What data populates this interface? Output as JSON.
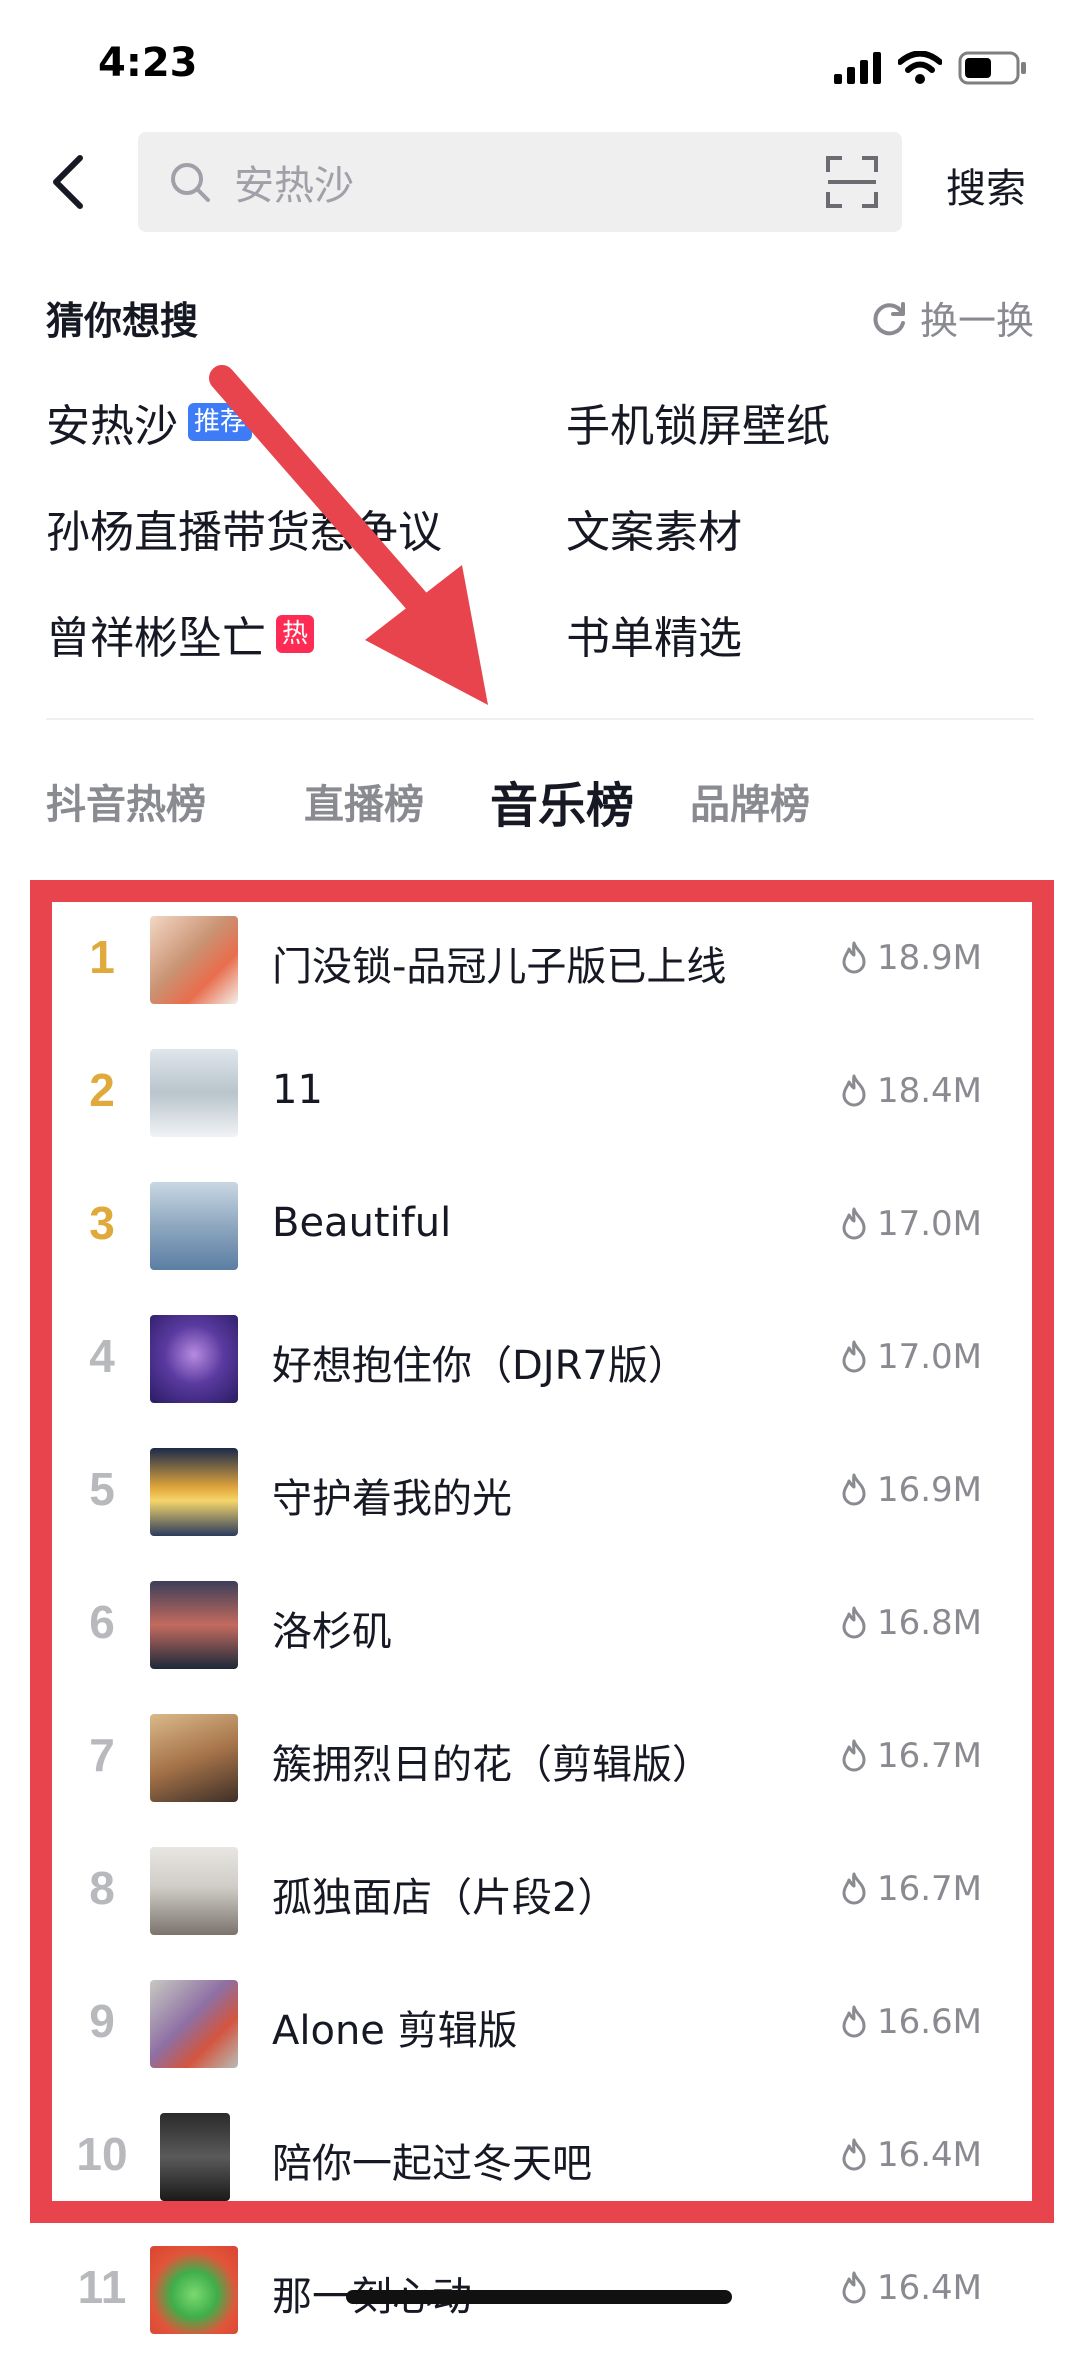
{
  "status_bar": {
    "time": "4:23"
  },
  "search": {
    "placeholder": "安热沙",
    "button_label": "搜索"
  },
  "guess": {
    "title": "猜你想搜",
    "refresh_label": "换一换",
    "items": [
      {
        "text": "安热沙",
        "badge": "推荐",
        "badge_color": "#3d7bf7"
      },
      {
        "text": "手机锁屏壁纸"
      },
      {
        "text": "孙杨直播带货惹争议"
      },
      {
        "text": "文案素材"
      },
      {
        "text": "曾祥彬坠亡",
        "badge": "热",
        "badge_color": "#fe2c55"
      },
      {
        "text": "书单精选"
      }
    ]
  },
  "tabs": [
    {
      "label": "抖音热榜"
    },
    {
      "label": "直播榜"
    },
    {
      "label": "音乐榜",
      "active": true
    },
    {
      "label": "品牌榜"
    }
  ],
  "music_chart": [
    {
      "rank": "1",
      "title": "门没锁-品冠儿子版已上线",
      "heat": "18.9M"
    },
    {
      "rank": "2",
      "title": "11",
      "heat": "18.4M"
    },
    {
      "rank": "3",
      "title": "Beautiful",
      "heat": "17.0M"
    },
    {
      "rank": "4",
      "title": "好想抱住你（DJR7版）",
      "heat": "17.0M"
    },
    {
      "rank": "5",
      "title": "守护着我的光",
      "heat": "16.9M"
    },
    {
      "rank": "6",
      "title": "洛杉矶",
      "heat": "16.8M"
    },
    {
      "rank": "7",
      "title": "簇拥烈日的花（剪辑版）",
      "heat": "16.7M"
    },
    {
      "rank": "8",
      "title": "孤独面店（片段2）",
      "heat": "16.7M"
    },
    {
      "rank": "9",
      "title": "Alone 剪辑版",
      "heat": "16.6M"
    },
    {
      "rank": "10",
      "title": "陪你一起过冬天吧",
      "heat": "16.4M"
    },
    {
      "rank": "11",
      "title": "那一刻心动",
      "heat": "16.4M"
    }
  ],
  "colors": {
    "highlight": "#e8444d",
    "top_rank": "#e0a93b"
  }
}
